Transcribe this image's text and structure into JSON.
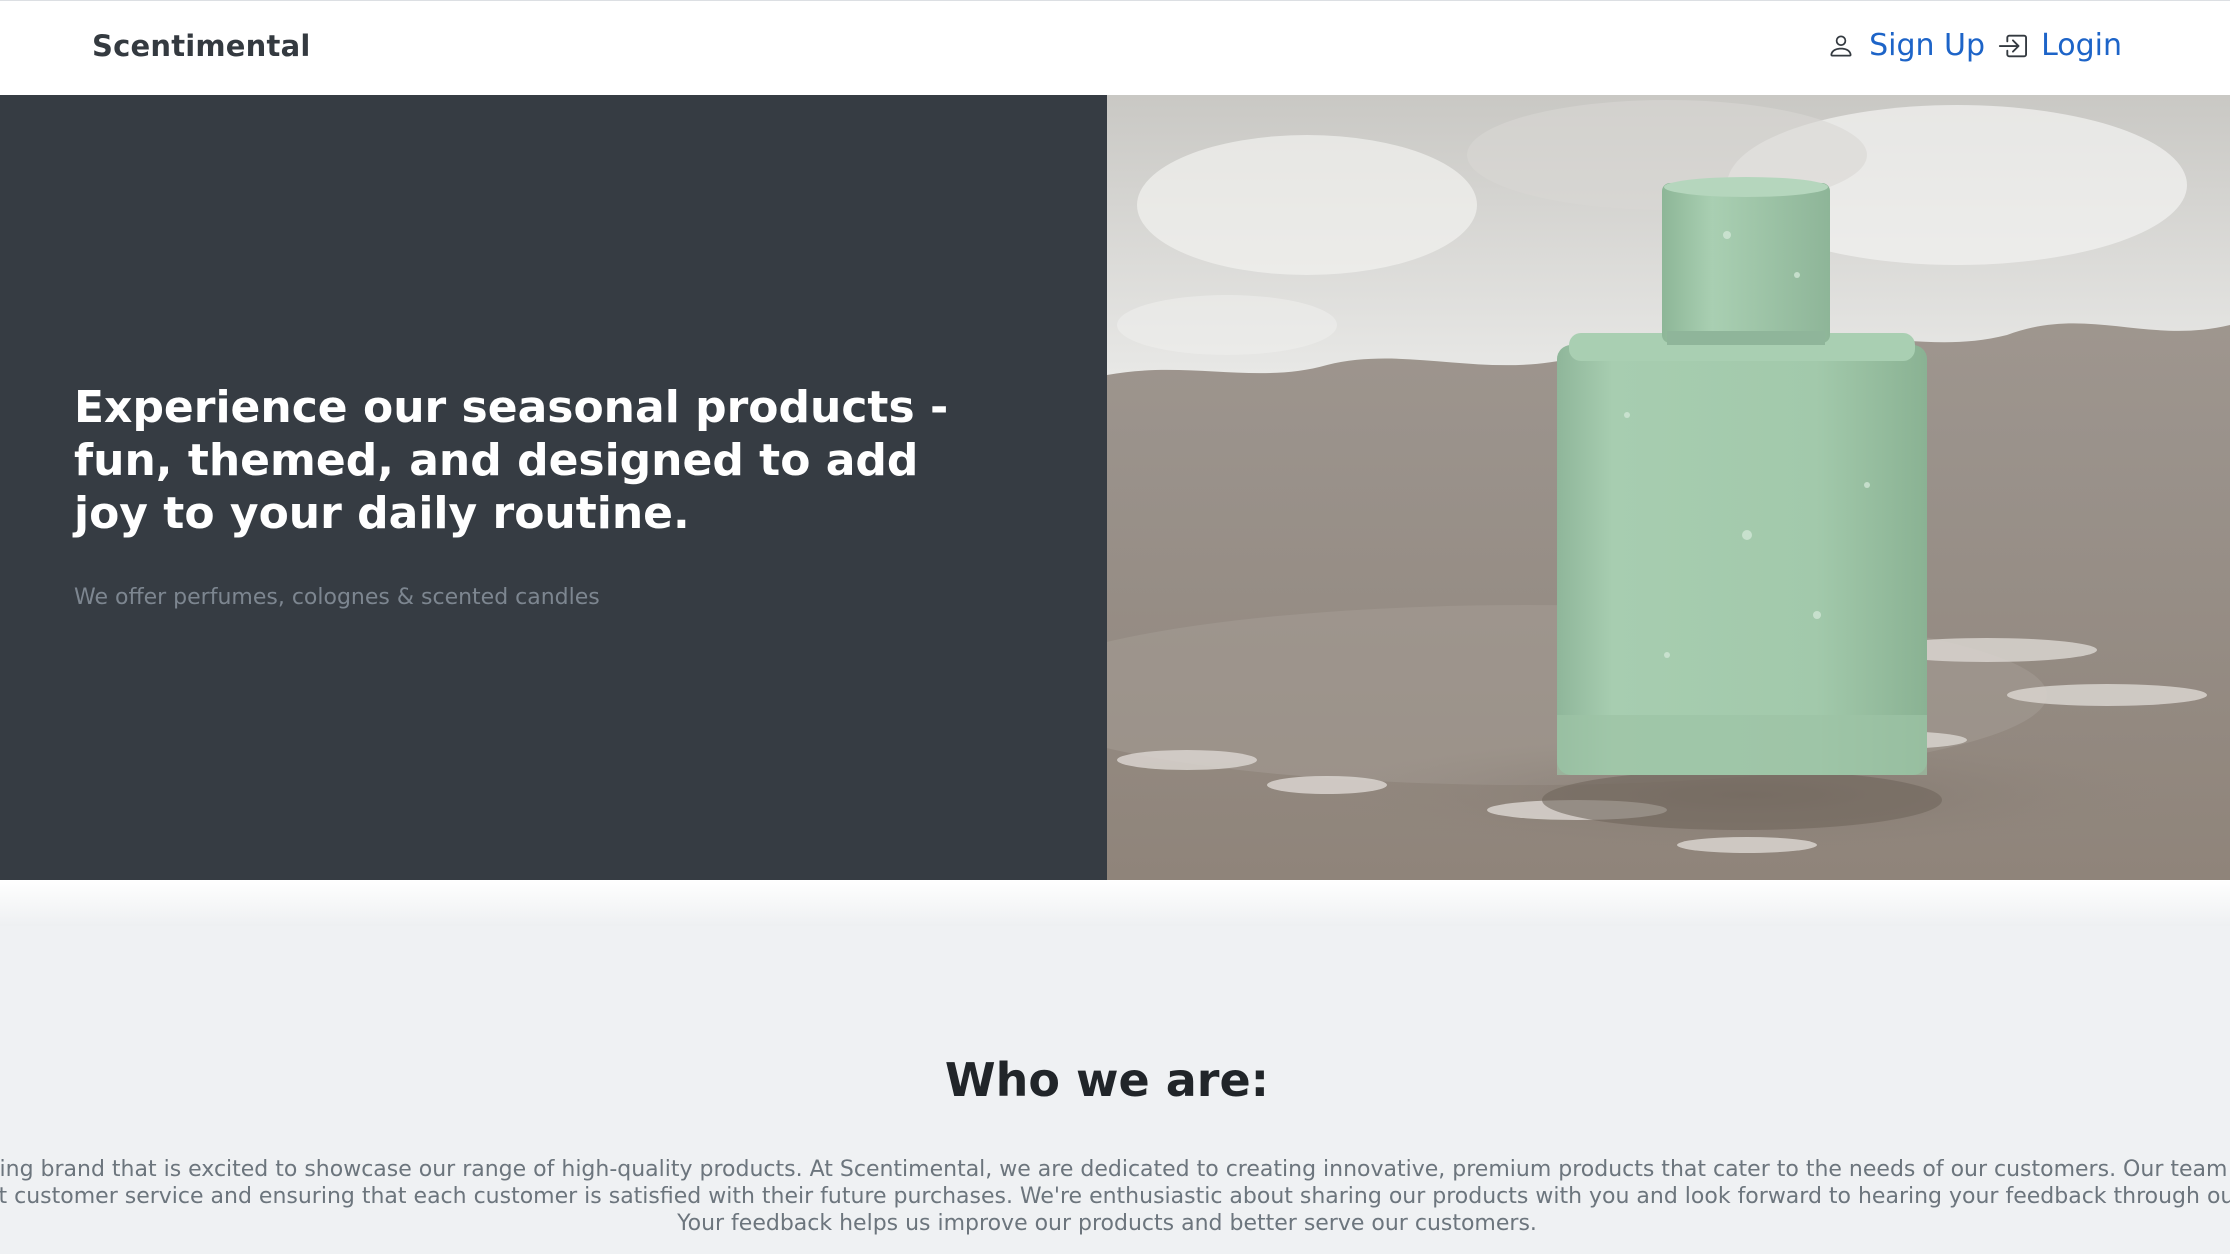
{
  "navbar": {
    "brand": "Scentimental",
    "signup_label": "Sign Up",
    "login_label": "Login",
    "signup_icon": "person-icon",
    "login_icon": "box-arrow-in-right-icon"
  },
  "hero": {
    "title": "Experience our seasonal products - fun, themed, and designed to add joy to your daily routine.",
    "subtitle": "We offer perfumes, colognes & scented candles",
    "image": "green-perfume-bottle-on-beach"
  },
  "about": {
    "title": "Who we are:",
    "text": "We are an upcoming brand that is excited to showcase our range of high-quality products. At Scentimental, we are dedicated to creating innovative, premium products that cater to the needs of our customers. Our team is committed to providing excellent customer service and ensuring that each customer is satisfied with their future purchases. We're enthusiastic about sharing our products with you and look forward to hearing your feedback through our review system. Your feedback helps us improve our products and better serve our customers."
  },
  "colors": {
    "hero_dark": "#363c43",
    "link": "#1d64c8",
    "about_bg": "#eff1f3"
  }
}
